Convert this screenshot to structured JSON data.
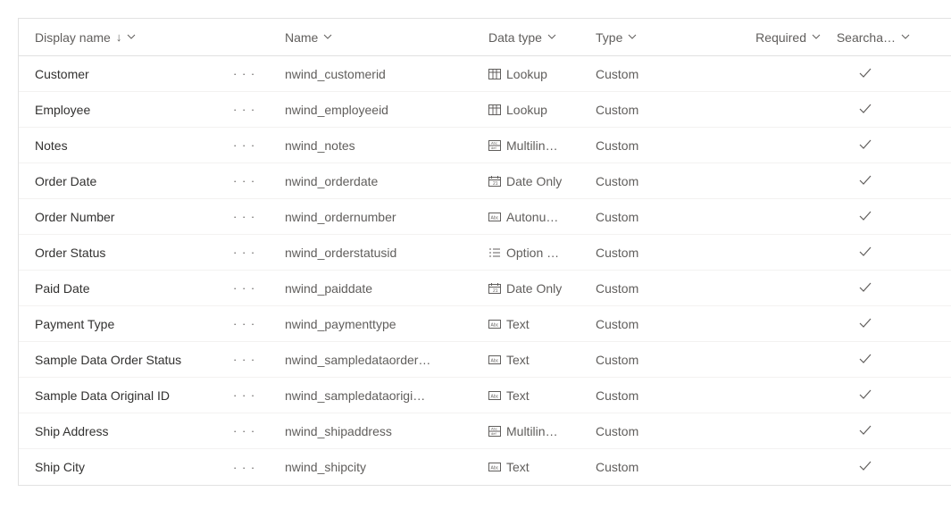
{
  "headers": {
    "display_name": "Display name",
    "name": "Name",
    "data_type": "Data type",
    "type": "Type",
    "required": "Required",
    "searchable": "Searcha…"
  },
  "rows": [
    {
      "display": "Customer",
      "name": "nwind_customerid",
      "datatype": "Lookup",
      "icon": "lookup",
      "type": "Custom",
      "required": "",
      "searchable": true
    },
    {
      "display": "Employee",
      "name": "nwind_employeeid",
      "datatype": "Lookup",
      "icon": "lookup",
      "type": "Custom",
      "required": "",
      "searchable": true
    },
    {
      "display": "Notes",
      "name": "nwind_notes",
      "datatype": "Multilin…",
      "icon": "multiline",
      "type": "Custom",
      "required": "",
      "searchable": true
    },
    {
      "display": "Order Date",
      "name": "nwind_orderdate",
      "datatype": "Date Only",
      "icon": "date",
      "type": "Custom",
      "required": "",
      "searchable": true
    },
    {
      "display": "Order Number",
      "name": "nwind_ordernumber",
      "datatype": "Autonu…",
      "icon": "text",
      "type": "Custom",
      "required": "",
      "searchable": true
    },
    {
      "display": "Order Status",
      "name": "nwind_orderstatusid",
      "datatype": "Option …",
      "icon": "option",
      "type": "Custom",
      "required": "",
      "searchable": true
    },
    {
      "display": "Paid Date",
      "name": "nwind_paiddate",
      "datatype": "Date Only",
      "icon": "date",
      "type": "Custom",
      "required": "",
      "searchable": true
    },
    {
      "display": "Payment Type",
      "name": "nwind_paymenttype",
      "datatype": "Text",
      "icon": "text",
      "type": "Custom",
      "required": "",
      "searchable": true
    },
    {
      "display": "Sample Data Order Status",
      "name": "nwind_sampledataorder…",
      "datatype": "Text",
      "icon": "text",
      "type": "Custom",
      "required": "",
      "searchable": true
    },
    {
      "display": "Sample Data Original ID",
      "name": "nwind_sampledataorigi…",
      "datatype": "Text",
      "icon": "text",
      "type": "Custom",
      "required": "",
      "searchable": true
    },
    {
      "display": "Ship Address",
      "name": "nwind_shipaddress",
      "datatype": "Multilin…",
      "icon": "multiline",
      "type": "Custom",
      "required": "",
      "searchable": true
    },
    {
      "display": "Ship City",
      "name": "nwind_shipcity",
      "datatype": "Text",
      "icon": "text",
      "type": "Custom",
      "required": "",
      "searchable": true
    }
  ]
}
